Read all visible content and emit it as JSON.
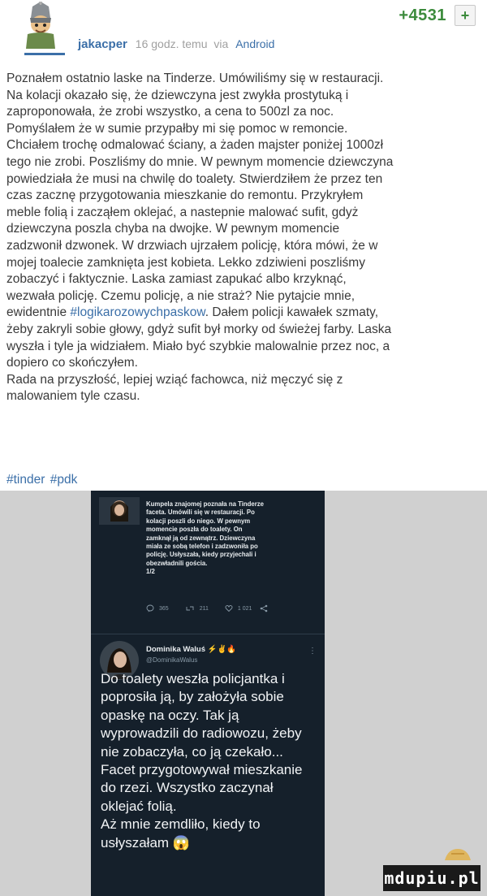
{
  "header": {
    "author": "jakacper",
    "time": "16 godz. temu",
    "via": "via",
    "source": "Android",
    "votes": "+4531",
    "plus": "+"
  },
  "post": {
    "text_before": "Poznałem ostatnio laske na Tinderze. Umówiliśmy się w restauracji.\nNa kolacji okazało się, że dziewczyna jest zwykła prostytuką i\nzaproponowała, że zrobi wszystko, a cena to 500zl za noc.\nPomyślałem że w sumie przypałby mi się pomoc w remoncie.\nChciałem trochę odmalować ściany, a żaden majster poniżej 1000zł\ntego nie zrobi. Poszliśmy do mnie. W pewnym momencie dziewczyna\npowiedziała że musi na chwilę do toalety. Stwierdziłem że przez ten\nczas zacznę przygotowania mieszkanie do remontu. Przykryłem\nmeble folią i zacząłem oklejać, a nastepnie malować sufit, gdyż\ndziewczyna poszla chyba na dwojke. W pewnym momencie\nzadzwonił dzwonek. W drzwiach ujrzałem policję, która mówi, że w\nmojej toalecie zamknięta jest kobieta. Lekko zdziwieni poszliśmy\nzobaczyć i faktycznie. Laska zamiast zapukać albo krzyknąć,\nwezwała policję. Czemu policję, a nie straż? Nie pytajcie mnie,\newidentnie ",
    "hashtag_inline": "#logikarozowychpaskow",
    "text_after": ". Dałem policji kawałek szmaty,\nżeby zakryli sobie głowy, gdyż sufit był morky od świeżej farby. Laska\nwyszła i tyle ja widziałem. Miało być szybkie malowalnie przez noc, a\ndopiero co skończyłem.\nRada na przyszłość, lepiej wziąć fachowca, niż męczyć się z\nmalowaniem tyle czasu.",
    "tags": [
      "#tinder",
      "#pdk"
    ]
  },
  "embed": {
    "tweet1": {
      "text": "Kumpela znajomej poznała na Tinderze\nfaceta. Umówili się w restauracji. Po\nkolacji poszli do niego. W pewnym\nmomencie poszła do toalety. On\nzamknął ją od zewnątrz. Dziewczyna\nmiała ze sobą telefon i zadzwoniła po\npolicję. Usłyszała, kiedy przyjechali i\nobezwładnili gościa.\n1/2",
      "replies": "365",
      "retweets": "211",
      "likes": "1 021"
    },
    "tweet2": {
      "name": "Dominika Waluś",
      "name_emoji": "⚡✌🔥",
      "handle": "@DominikaWalus",
      "text": "Do toalety weszła policjantka i\npoprosiła ją, by założyła sobie\nopaskę na oczy. Tak ją\nwyprowadzili do radiowozu, żeby\nnie zobaczyła, co ją czekało...\nFacet przygotowywał mieszkanie\ndo rzezi. Wszystko zaczynał\noklejać folią.\nAż mnie zemdliło, kiedy to\nusłyszałam 😱"
    },
    "watermark": "mdupiu.pl"
  },
  "colors": {
    "link": "#3b6fa8",
    "votes": "#3c8b3c",
    "tweet_bg": "#15202b"
  }
}
